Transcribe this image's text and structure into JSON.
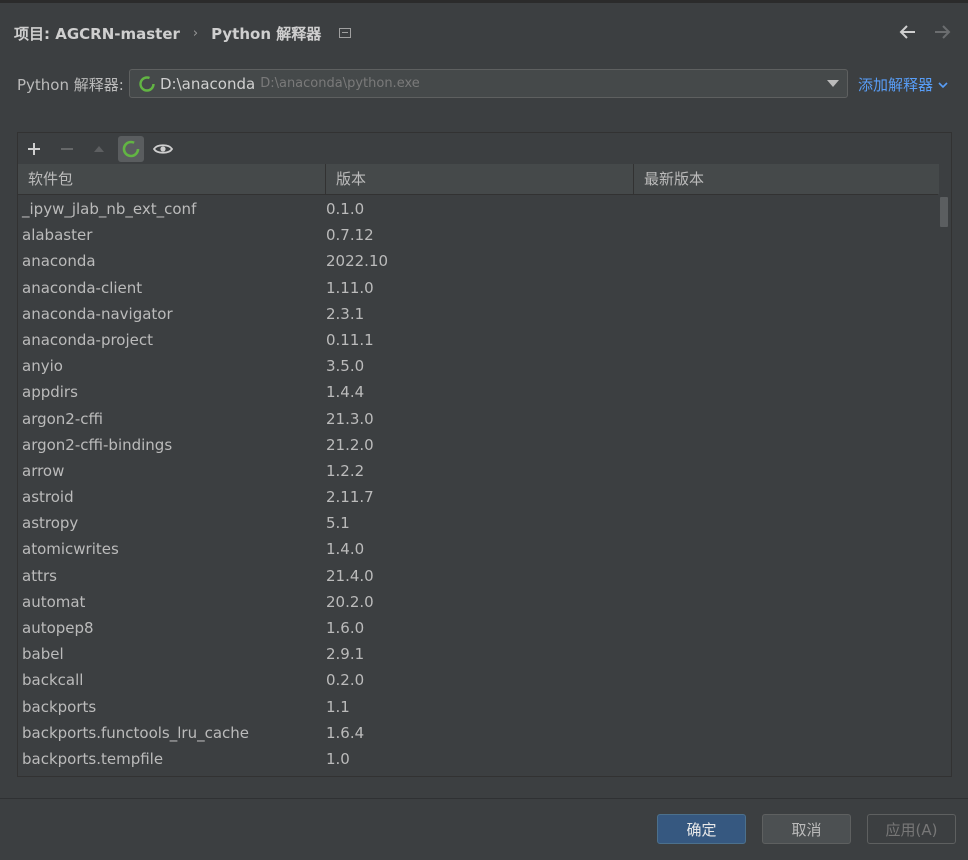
{
  "header": {
    "project_label": "项目: AGCRN-master",
    "separator": "›",
    "page_title": "Python 解释器"
  },
  "interpreter": {
    "label": "Python 解释器:",
    "selected_name": "D:\\anaconda",
    "selected_path": "D:\\anaconda\\python.exe",
    "add_label": "添加解释器"
  },
  "toolbar": {
    "icons": [
      "plus-icon",
      "minus-icon",
      "up-arrow-icon",
      "refresh-spinner-icon",
      "eye-icon"
    ]
  },
  "table": {
    "columns": [
      "软件包",
      "版本",
      "最新版本"
    ],
    "rows": [
      {
        "name": "_ipyw_jlab_nb_ext_conf",
        "version": "0.1.0",
        "latest": ""
      },
      {
        "name": "alabaster",
        "version": "0.7.12",
        "latest": ""
      },
      {
        "name": "anaconda",
        "version": "2022.10",
        "latest": ""
      },
      {
        "name": "anaconda-client",
        "version": "1.11.0",
        "latest": ""
      },
      {
        "name": "anaconda-navigator",
        "version": "2.3.1",
        "latest": ""
      },
      {
        "name": "anaconda-project",
        "version": "0.11.1",
        "latest": ""
      },
      {
        "name": "anyio",
        "version": "3.5.0",
        "latest": ""
      },
      {
        "name": "appdirs",
        "version": "1.4.4",
        "latest": ""
      },
      {
        "name": "argon2-cffi",
        "version": "21.3.0",
        "latest": ""
      },
      {
        "name": "argon2-cffi-bindings",
        "version": "21.2.0",
        "latest": ""
      },
      {
        "name": "arrow",
        "version": "1.2.2",
        "latest": ""
      },
      {
        "name": "astroid",
        "version": "2.11.7",
        "latest": ""
      },
      {
        "name": "astropy",
        "version": "5.1",
        "latest": ""
      },
      {
        "name": "atomicwrites",
        "version": "1.4.0",
        "latest": ""
      },
      {
        "name": "attrs",
        "version": "21.4.0",
        "latest": ""
      },
      {
        "name": "automat",
        "version": "20.2.0",
        "latest": ""
      },
      {
        "name": "autopep8",
        "version": "1.6.0",
        "latest": ""
      },
      {
        "name": "babel",
        "version": "2.9.1",
        "latest": ""
      },
      {
        "name": "backcall",
        "version": "0.2.0",
        "latest": ""
      },
      {
        "name": "backports",
        "version": "1.1",
        "latest": ""
      },
      {
        "name": "backports.functools_lru_cache",
        "version": "1.6.4",
        "latest": ""
      },
      {
        "name": "backports.tempfile",
        "version": "1.0",
        "latest": ""
      }
    ]
  },
  "footer": {
    "ok_label": "确定",
    "cancel_label": "取消",
    "apply_label": "应用(A)"
  },
  "colors": {
    "background": "#3c3f41",
    "accent_link": "#589df6",
    "primary_button": "#365880",
    "spinner": "#62b543"
  }
}
